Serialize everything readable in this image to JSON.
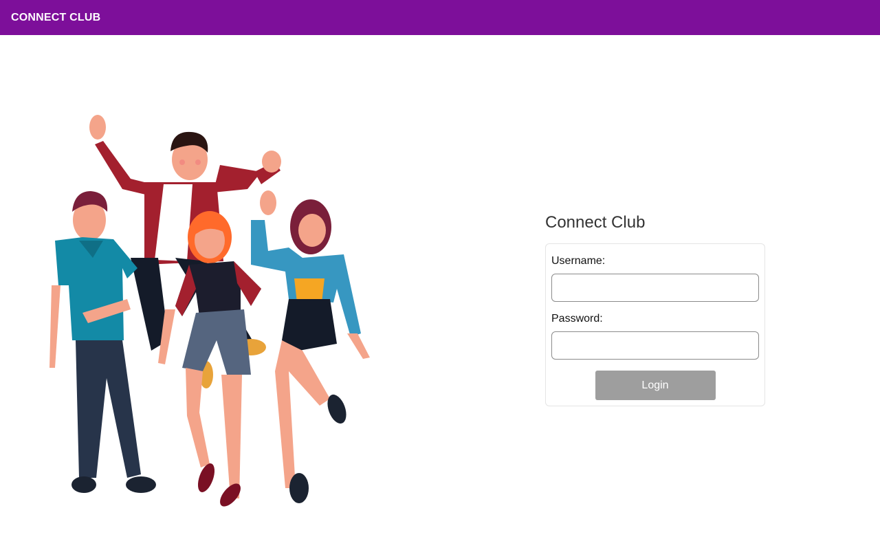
{
  "header": {
    "brand": "CONNECT CLUB"
  },
  "colors": {
    "header_bg": "#7d0f9a",
    "button_bg": "#9e9e9e"
  },
  "illustration": {
    "icon": "friends-group-illustration"
  },
  "login": {
    "title": "Connect Club",
    "username_label": "Username:",
    "username_value": "",
    "password_label": "Password:",
    "password_value": "",
    "button_label": "Login"
  }
}
